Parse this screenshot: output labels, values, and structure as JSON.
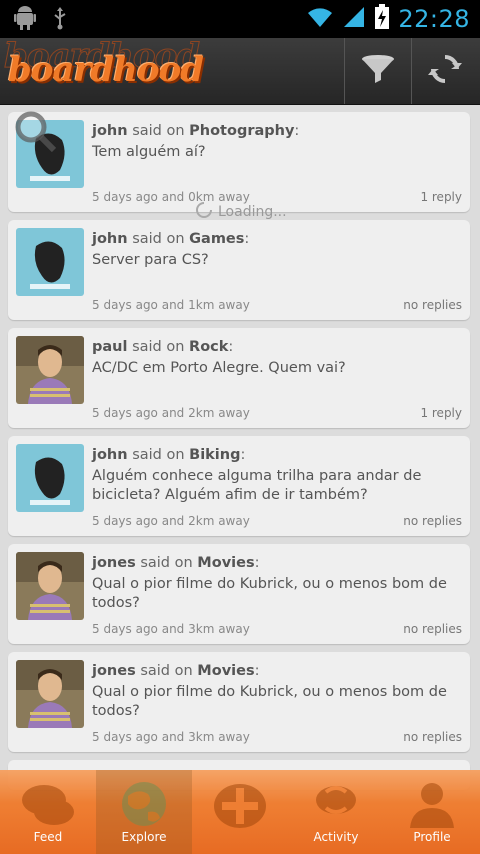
{
  "status": {
    "time": "22:28"
  },
  "app": {
    "logo": "boardhood"
  },
  "loading": "Loading...",
  "posts": [
    {
      "user": "john",
      "said": "said on",
      "topic": "Photography",
      "text": "Tem alguém aí?",
      "time": "5 days ago and 0km away",
      "replies": "1 reply",
      "avatar": "poster"
    },
    {
      "user": "john",
      "said": "said on",
      "topic": "Games",
      "text": "Server para CS?",
      "time": "5 days ago and 1km away",
      "replies": "no replies",
      "avatar": "poster"
    },
    {
      "user": "paul",
      "said": "said on",
      "topic": "Rock",
      "text": "AC/DC em Porto Alegre. Quem vai?",
      "time": "5 days ago and 2km away",
      "replies": "1 reply",
      "avatar": "person"
    },
    {
      "user": "john",
      "said": "said on",
      "topic": "Biking",
      "text": "Alguém conhece alguma trilha para andar de bicicleta? Alguém afim de ir também?",
      "time": "5 days ago and 2km away",
      "replies": "no replies",
      "avatar": "poster"
    },
    {
      "user": "jones",
      "said": "said on",
      "topic": "Movies",
      "text": "Qual o pior filme do Kubrick, ou o menos bom de todos?",
      "time": "5 days ago and 3km away",
      "replies": "no replies",
      "avatar": "person"
    },
    {
      "user": "jones",
      "said": "said on",
      "topic": "Movies",
      "text": "Qual o pior filme do Kubrick, ou o menos bom de todos?",
      "time": "5 days ago and 3km away",
      "replies": "no replies",
      "avatar": "person"
    }
  ],
  "tabs": [
    {
      "label": "Feed",
      "icon": "chat-bubbles-icon"
    },
    {
      "label": "Explore",
      "icon": "globe-icon"
    },
    {
      "label": "",
      "icon": "add-icon"
    },
    {
      "label": "Activity",
      "icon": "activity-icon"
    },
    {
      "label": "Profile",
      "icon": "profile-icon"
    }
  ],
  "colors": {
    "accent": "#f07a28",
    "clock": "#35b5e5",
    "topbar": "#2e2e2e"
  }
}
